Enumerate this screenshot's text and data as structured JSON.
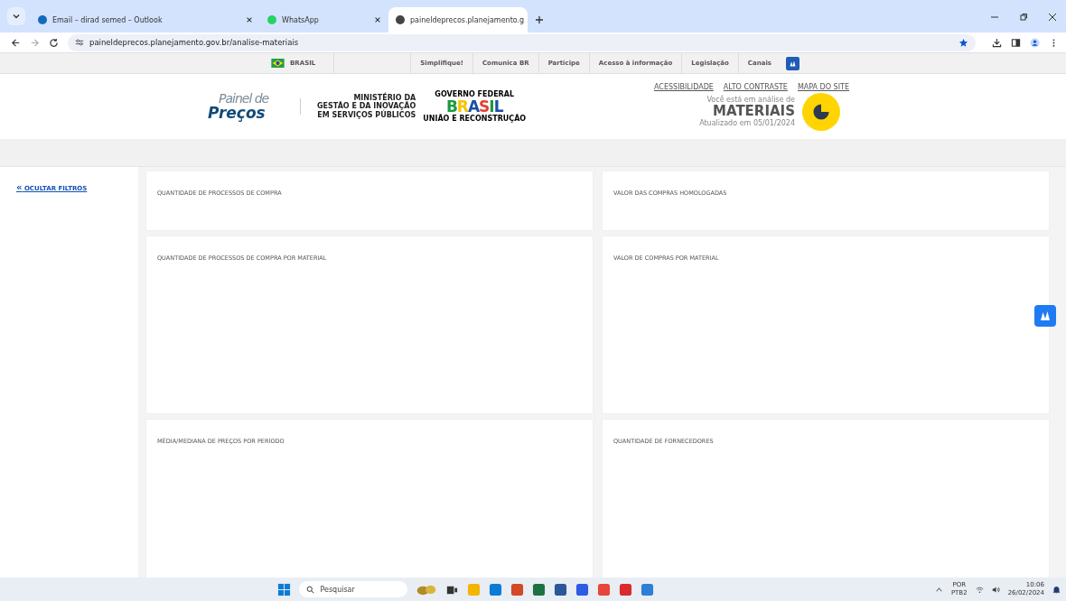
{
  "browser": {
    "tabs": [
      {
        "label": "Email – dirad semed – Outlook",
        "selected": false
      },
      {
        "label": "WhatsApp",
        "selected": false
      },
      {
        "label": "paineldeprecos.planejamento.g",
        "selected": true
      }
    ],
    "url": "paineldeprecos.planejamento.gov.br/analise-materiais"
  },
  "gov_bar": {
    "country": "BRASIL",
    "links": [
      "Simplifique!",
      "Comunica BR",
      "Participe",
      "Acesso à informação",
      "Legislação",
      "Canais"
    ]
  },
  "header": {
    "logo_top": "Painel de",
    "logo_bottom": "Preços",
    "ministry": [
      "MINISTÉRIO DA",
      "GESTÃO E DA INOVAÇÃO",
      "EM SERVIÇOS PÚBLICOS"
    ],
    "gov_top": "GOVERNO FEDERAL",
    "gov_word": "BRASIL",
    "gov_bottom": "UNIÃO E RECONSTRUÇÃO",
    "access_links": [
      "ACESSIBILIDADE",
      "ALTO CONTRASTE",
      "MAPA DO SITE"
    ],
    "analysis_intro": "Você está em análise de",
    "analysis_title": "MATERIAIS",
    "updated": "Atualizado em 05/01/2024"
  },
  "sidebar": {
    "toggle_icon": "«",
    "toggle_label": "OCULTAR FILTROS"
  },
  "cards": [
    {
      "title": "QUANTIDADE DE PROCESSOS DE COMPRA"
    },
    {
      "title": "VALOR DAS COMPRAS HOMOLOGADAS"
    },
    {
      "title": "QUANTIDADE DE PROCESSOS DE COMPRA POR MATERIAL"
    },
    {
      "title": "VALOR DE COMPRAS POR MATERIAL"
    },
    {
      "title": "MÉDIA/MEDIANA DE PREÇOS POR PERÍODO"
    },
    {
      "title": "QUANTIDADE DE FORNECEDORES"
    }
  ],
  "taskbar": {
    "search_placeholder": "Pesquisar",
    "language": "POR",
    "layout": "PTB2",
    "time": "10:06",
    "date": "26/02/2024"
  }
}
